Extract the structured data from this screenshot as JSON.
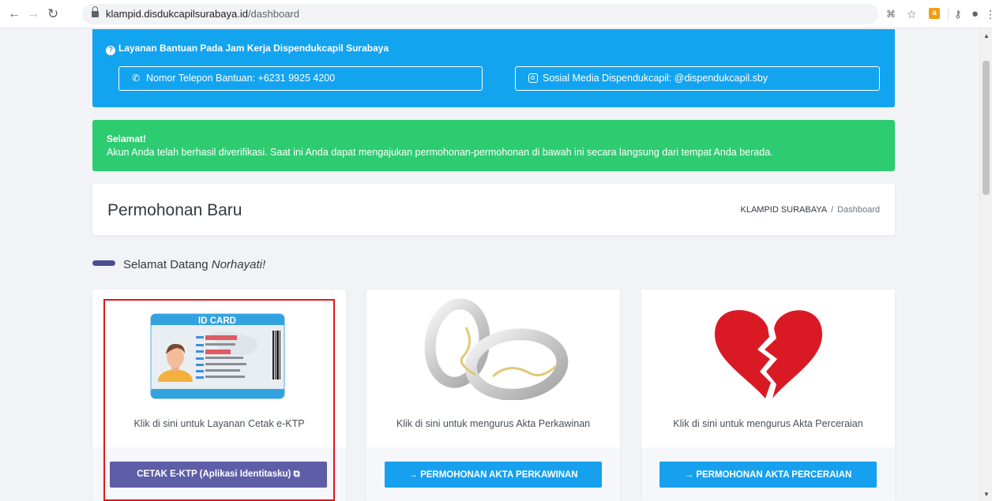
{
  "browser": {
    "url_host": "klampid.disdukcapilsurabaya.id",
    "url_path": "/dashboard"
  },
  "info": {
    "title": "Layanan Bantuan Pada Jam Kerja Dispendukcapil Surabaya",
    "phone": "Nomor Telepon Bantuan: +6231 9925 4200",
    "social": "Sosial Media Dispendukcapil: @dispendukcapil.sby"
  },
  "success": {
    "title": "Selamat!",
    "message": "Akun Anda telah berhasil diverifikasi. Saat ini Anda dapat mengajukan permohonan-permohonan di bawah ini secara langsung dari tempat Anda berada."
  },
  "header": {
    "title": "Permohonan Baru",
    "breadcrumb_root": "KLAMPID SURABAYA",
    "breadcrumb_sep": "/",
    "breadcrumb_current": "Dashboard"
  },
  "welcome": {
    "prefix": "Selamat Datang",
    "name": "Norhayati!"
  },
  "cards": [
    {
      "image_label": "ID CARD",
      "caption": "Klik di sini untuk Layanan Cetak e-KTP",
      "button": "CETAK E-KTP (Aplikasi Identitasku)"
    },
    {
      "caption": "Klik di sini untuk mengurus Akta Perkawinan",
      "button": "→ PERMOHONAN AKTA PERKAWINAN"
    },
    {
      "caption": "Klik di sini untuk mengurus Akta Perceraian",
      "button": "→ PERMOHONAN AKTA PERCERAIAN"
    }
  ],
  "colors": {
    "info": "#13a4f0",
    "success": "#2ecc71",
    "purple_button": "#5e5ea8",
    "blue_button": "#16a0ee",
    "highlight": "#e8141b"
  }
}
